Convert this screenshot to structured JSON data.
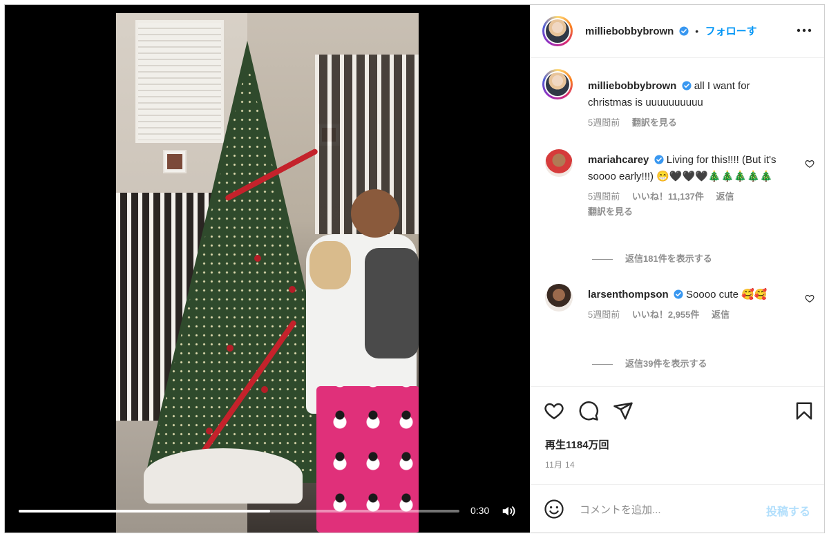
{
  "video": {
    "time": "0:30",
    "progress": 0.57,
    "volume_icon": "speaker-icon"
  },
  "post": {
    "author": "milliebobbybrown",
    "separator": "•",
    "follow_label": "フォローす",
    "more_icon": "more-horizontal-icon",
    "caption_user": "milliebobbybrown",
    "caption_text": "all I want for christmas is uuuuuuuuuu",
    "caption_time": "5週間前",
    "caption_translate": "翻訳を見る"
  },
  "comments": [
    {
      "user": "mariahcarey",
      "text": "Living for this!!!! (But it's soooo early!!!) 😁🖤🖤🖤🎄🎄🎄🎄🎄",
      "time": "5週間前",
      "likes": "いいね！11,137件",
      "reply": "返信",
      "translate": "翻訳を見る",
      "replies_toggle": "返信181件を表示する"
    },
    {
      "user": "larsenthompson",
      "text": "Soooo cute 🥰🥰",
      "time": "5週間前",
      "likes": "いいね！2,955件",
      "reply": "返信",
      "replies_toggle": "返信39件を表示する"
    }
  ],
  "actions": {
    "like_icon": "heart-icon",
    "comment_icon": "comment-icon",
    "share_icon": "send-icon",
    "save_icon": "bookmark-icon",
    "views": "再生1184万回",
    "date": "11月 14"
  },
  "composer": {
    "emoji_icon": "emoji-icon",
    "placeholder": "コメントを追加...",
    "post_label": "投稿する"
  },
  "colors": {
    "accent": "#0095f6",
    "post_disabled": "#b2dffc",
    "verified": "#3897f0"
  }
}
